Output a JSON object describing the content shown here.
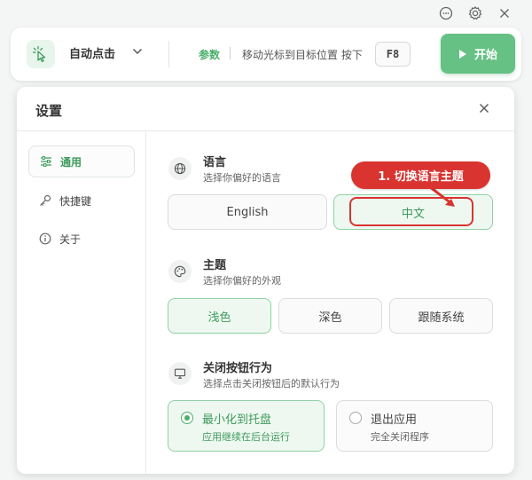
{
  "window": {
    "controls": [
      {
        "icon": "chat-icon"
      },
      {
        "icon": "gear-icon"
      },
      {
        "icon": "close-icon"
      }
    ]
  },
  "toolbar": {
    "app_icon": "cursor-click-icon",
    "app_name": "自动点击",
    "dropdown_icon": "chevron-down-icon",
    "param_label": "参数",
    "hint_text": "移动光标到目标位置 按下",
    "hotkey": "F8",
    "start_label": "开始",
    "start_icon": "play-icon"
  },
  "dialog": {
    "title": "设置",
    "close_icon": "close-icon",
    "sidebar": [
      {
        "label": "通用",
        "icon": "sliders-icon",
        "active": true
      },
      {
        "label": "快捷键",
        "icon": "key-icon",
        "active": false
      },
      {
        "label": "关于",
        "icon": "info-icon",
        "active": false
      }
    ],
    "language": {
      "icon": "globe-icon",
      "title": "语言",
      "subtitle": "选择你偏好的语言",
      "options": [
        "English",
        "中文"
      ],
      "selected": "中文"
    },
    "theme": {
      "icon": "palette-icon",
      "title": "主题",
      "subtitle": "选择你偏好的外观",
      "options": [
        "浅色",
        "深色",
        "跟随系统"
      ],
      "selected": "浅色"
    },
    "close_behavior": {
      "icon": "monitor-icon",
      "title": "关闭按钮行为",
      "subtitle": "选择点击关闭按钮后的默认行为",
      "options": [
        {
          "title": "最小化到托盘",
          "subtitle": "应用继续在后台运行",
          "selected": true
        },
        {
          "title": "退出应用",
          "subtitle": "完全关闭程序",
          "selected": false
        }
      ]
    }
  },
  "annotation": {
    "text": "1. 切换语言主题",
    "color": "#d93430"
  },
  "colors": {
    "accent": "#4caf6a",
    "start_button": "#66c184",
    "selected_bg": "#eef8f1",
    "annotation": "#d93430"
  }
}
